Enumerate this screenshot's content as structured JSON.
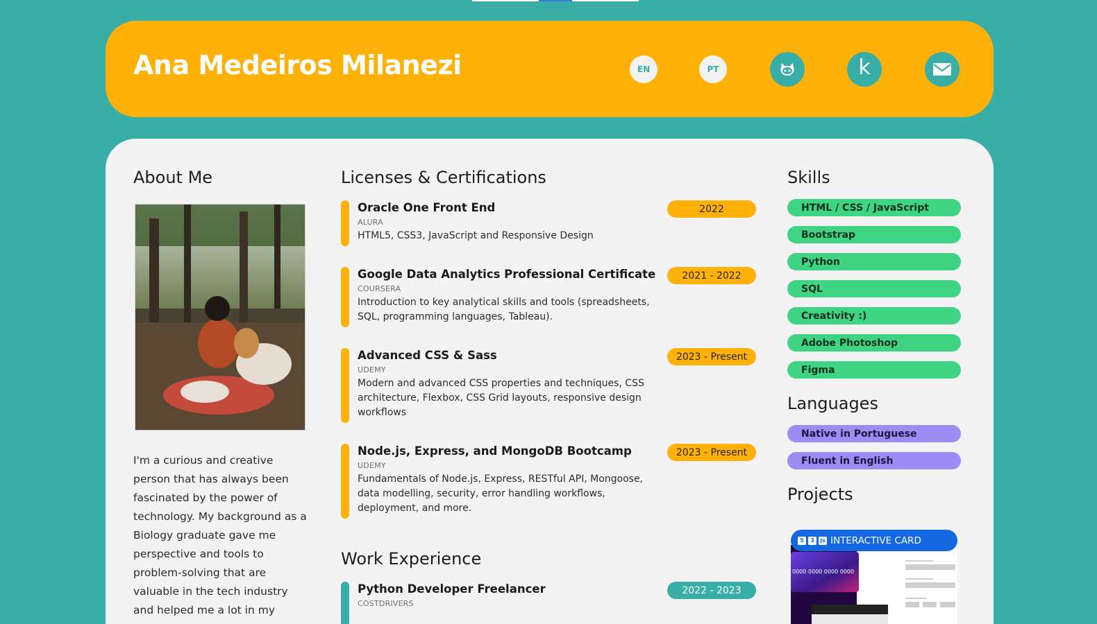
{
  "header": {
    "name": "Ana Medeiros Milanezi",
    "lang_en": "EN",
    "lang_pt": "PT",
    "social_icons": [
      "github-icon",
      "kaggle-icon",
      "email-icon"
    ],
    "kaggle_letter": "k"
  },
  "colors": {
    "background": "#38aea6",
    "header": "#ffb108",
    "card": "#f3f3f3",
    "skill_pill": "#3fd484",
    "language_pill": "#9d8cf3",
    "project_title": "#1469e3"
  },
  "about": {
    "heading": "About Me",
    "text": "I'm a curious and creative person that has always been fascinated by the power of technology. My background as a Biology graduate gave me perspective and tools to problem-solving that are valuable in the tech industry and helped me a lot in my"
  },
  "certifications": {
    "heading": "Licenses & Certifications",
    "items": [
      {
        "title": "Oracle One Front End",
        "org": "ALURA",
        "desc": "HTML5, CSS3, JavaScript and Responsive Design",
        "period": "2022"
      },
      {
        "title": "Google Data Analytics Professional Certificate",
        "org": "COURSERA",
        "desc": "Introduction to key analytical skills and tools (spreadsheets, SQL, programming languages, Tableau).",
        "period": "2021 - 2022"
      },
      {
        "title": "Advanced CSS & Sass",
        "org": "UDEMY",
        "desc": "Modern and advanced CSS properties and techniques, CSS architecture, Flexbox, CSS Grid layouts, responsive design workflows",
        "period": "2023 - Present"
      },
      {
        "title": "Node.js, Express, and MongoDB Bootcamp",
        "org": "UDEMY",
        "desc": "Fundamentals of Node.js, Express, RESTful API, Mongoose, data modelling, security, error handling workflows, deployment, and more.",
        "period": "2023 - Present"
      }
    ]
  },
  "work": {
    "heading": "Work Experience",
    "items": [
      {
        "title": "Python Developer Freelancer",
        "org": "COSTDRIVERS",
        "period": "2022 - 2023"
      }
    ]
  },
  "skills": {
    "heading": "Skills",
    "items": [
      "HTML / CSS / JavaScript",
      "Bootstrap",
      "Python",
      "SQL",
      "Creativity :)",
      "Adobe Photoshop",
      "Figma"
    ]
  },
  "languages": {
    "heading": "Languages",
    "items": [
      "Native in Portuguese",
      "Fluent in English"
    ]
  },
  "projects": {
    "heading": "Projects",
    "items": [
      {
        "title": "INTERACTIVE CARD",
        "tech_icons": [
          "html5-icon",
          "css3-icon",
          "js-icon"
        ],
        "card_number": "0000 0000 0000 0000"
      }
    ]
  }
}
